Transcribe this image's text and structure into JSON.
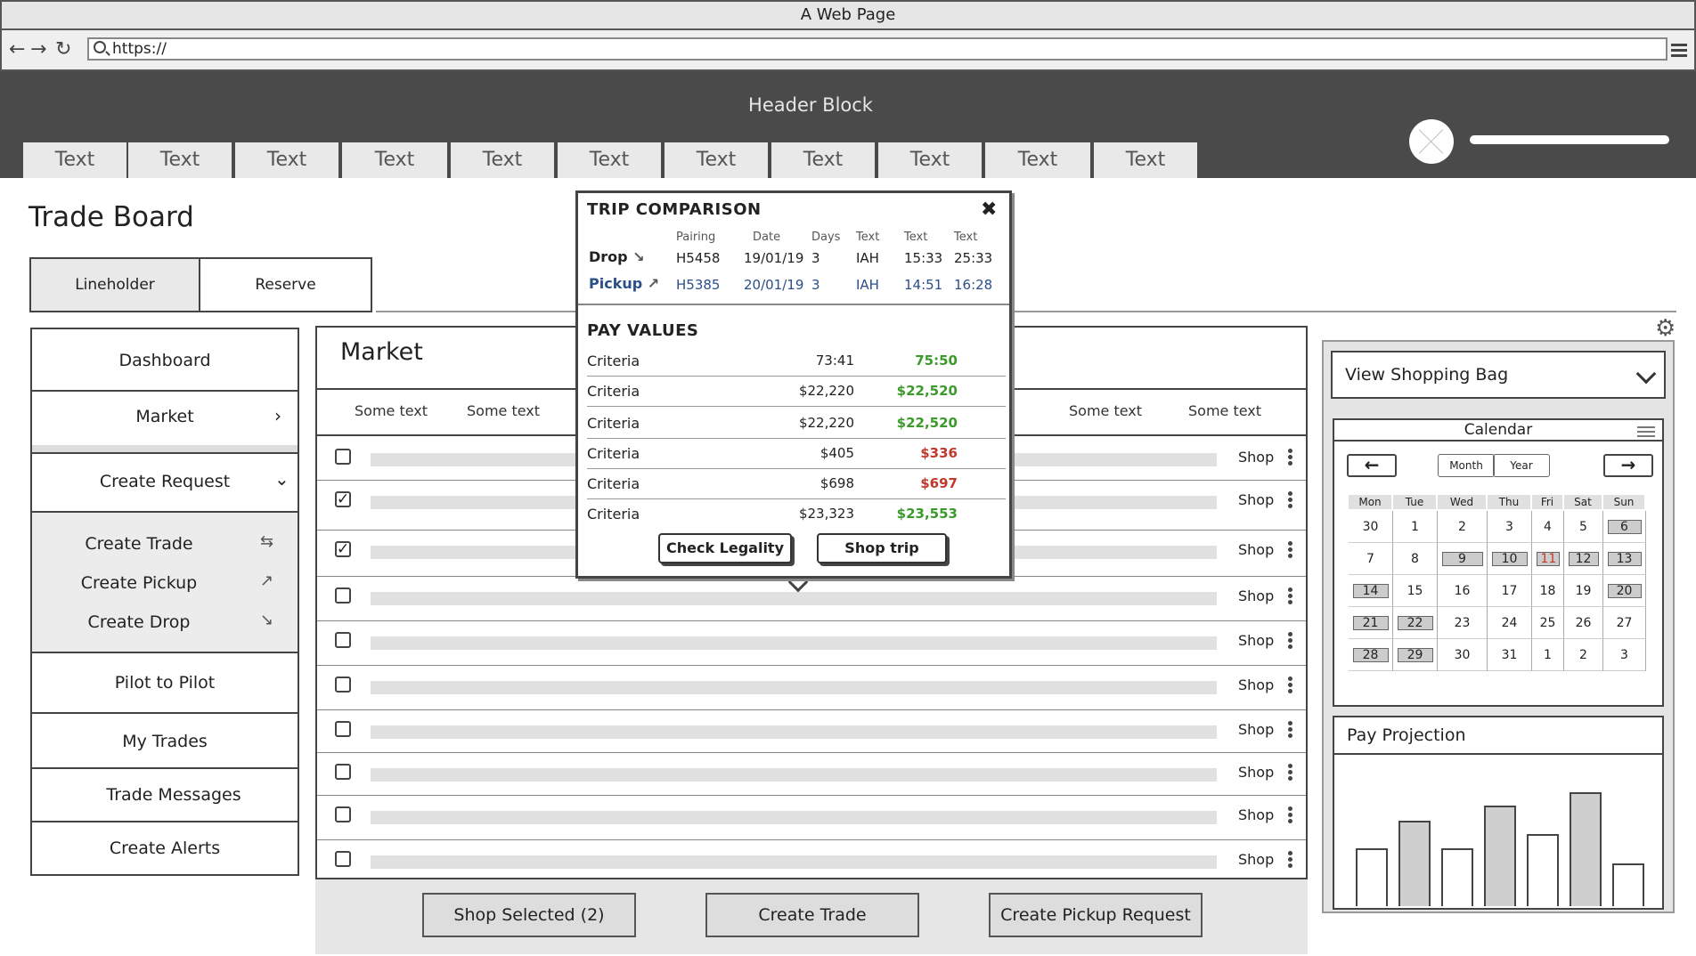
{
  "browser": {
    "title": "A Web Page",
    "url": "https://"
  },
  "header": {
    "title": "Header Block",
    "tabs": [
      "Text",
      "Text",
      "Text",
      "Text",
      "Text",
      "Text",
      "Text",
      "Text",
      "Text",
      "Text",
      "Text"
    ]
  },
  "page": {
    "title": "Trade Board",
    "segments": {
      "lineholder": "Lineholder",
      "reserve": "Reserve"
    }
  },
  "sidebar": {
    "dashboard": "Dashboard",
    "market": "Market",
    "create_request": "Create Request",
    "create_trade": "Create Trade",
    "create_pickup": "Create Pickup",
    "create_drop": "Create Drop",
    "pilot_to_pilot": "Pilot to Pilot",
    "my_trades": "My Trades",
    "trade_messages": "Trade Messages",
    "create_alerts": "Create Alerts"
  },
  "market": {
    "title": "Market",
    "columns": [
      "Some text",
      "Some text",
      "Some text",
      "Some text"
    ],
    "rows": [
      {
        "checked": false,
        "action": "Shop"
      },
      {
        "checked": true,
        "action": "Shop"
      },
      {
        "checked": true,
        "action": "Shop"
      },
      {
        "checked": false,
        "action": "Shop"
      },
      {
        "checked": false,
        "action": "Shop"
      },
      {
        "checked": false,
        "action": "Shop"
      },
      {
        "checked": false,
        "action": "Shop"
      },
      {
        "checked": false,
        "action": "Shop"
      },
      {
        "checked": false,
        "action": "Shop"
      },
      {
        "checked": false,
        "action": "Shop"
      }
    ]
  },
  "actions": {
    "shop_selected": "Shop Selected (2)",
    "create_trade": "Create Trade",
    "create_pickup_request": "Create Pickup Request"
  },
  "popup": {
    "title": "TRIP COMPARISON",
    "headers": [
      "Pairing",
      "Date",
      "Days",
      "Text",
      "Text",
      "Text"
    ],
    "drop": {
      "label": "Drop",
      "values": [
        "H5458",
        "19/01/19",
        "3",
        "IAH",
        "15:33",
        "25:33"
      ]
    },
    "pickup": {
      "label": "Pickup",
      "values": [
        "H5385",
        "20/01/19",
        "3",
        "IAH",
        "14:51",
        "16:28"
      ]
    },
    "pay_title": "PAY VALUES",
    "pay_rows": [
      {
        "label": "Criteria",
        "a": "73:41",
        "b": "75:50",
        "color": "green"
      },
      {
        "label": "Criteria",
        "a": "$22,220",
        "b": "$22,520",
        "color": "green"
      },
      {
        "label": "Criteria",
        "a": "$22,220",
        "b": "$22,520",
        "color": "green"
      },
      {
        "label": "Criteria",
        "a": "$405",
        "b": "$336",
        "color": "red"
      },
      {
        "label": "Criteria",
        "a": "$698",
        "b": "$697",
        "color": "red"
      },
      {
        "label": "Criteria",
        "a": "$23,323",
        "b": "$23,553",
        "color": "green"
      }
    ],
    "check_legality": "Check Legality",
    "shop_trip": "Shop trip"
  },
  "right": {
    "shopping_bag": "View Shopping Bag",
    "calendar": {
      "title": "Calendar",
      "month": "Month",
      "year": "Year",
      "days": [
        "Mon",
        "Tue",
        "Wed",
        "Thu",
        "Fri",
        "Sat",
        "Sun"
      ],
      "weeks": [
        [
          "30",
          "1",
          "2",
          "3",
          "4",
          "5",
          "6"
        ],
        [
          "7",
          "8",
          "9",
          "10",
          "11",
          "12",
          "13"
        ],
        [
          "14",
          "15",
          "16",
          "17",
          "18",
          "19",
          "20"
        ],
        [
          "21",
          "22",
          "23",
          "24",
          "25",
          "26",
          "27"
        ],
        [
          "28",
          "29",
          "30",
          "31",
          "1",
          "2",
          "3"
        ]
      ],
      "highlighted": [
        "0-6",
        "1-2",
        "1-3",
        "1-4",
        "1-5",
        "1-6",
        "2-0",
        "2-6",
        "3-0",
        "3-1",
        "4-0",
        "4-1"
      ],
      "red_day": "1-4"
    },
    "pay_projection": {
      "title": "Pay Projection",
      "bars": [
        0.43,
        0.64,
        0.43,
        0.75,
        0.54,
        0.85,
        0.32
      ],
      "filled": [
        false,
        true,
        false,
        true,
        false,
        true,
        false
      ]
    }
  }
}
